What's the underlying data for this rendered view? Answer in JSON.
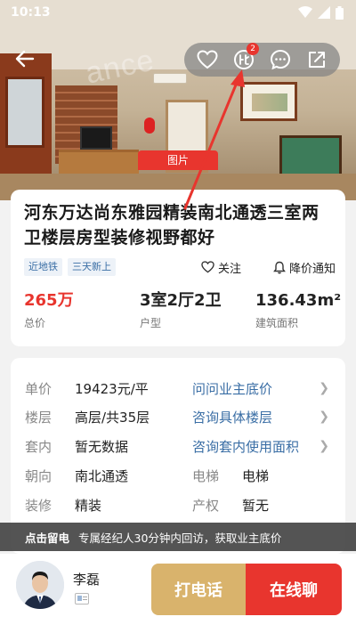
{
  "status_bar": {
    "time": "10:13",
    "icons": [
      "wifi-icon",
      "signal-icon",
      "battery-icon"
    ]
  },
  "hero": {
    "watermark": "ance",
    "photo_tag": "图片",
    "compare_badge": "2",
    "actions": [
      "heart-icon",
      "compare-icon",
      "chat-bubble-icon",
      "share-icon"
    ]
  },
  "listing": {
    "title": "河东万达尚东雅园精装南北通透三室两卫楼层房型装修视野都好",
    "tags": [
      "近地铁",
      "三天新上"
    ],
    "follow_label": "关注",
    "price_alert_label": "降价通知",
    "stats": [
      {
        "value": "265万",
        "label": "总价"
      },
      {
        "value": "3室2厅2卫",
        "label": "户型"
      },
      {
        "value": "136.43m²",
        "label": "建筑面积"
      }
    ]
  },
  "details": {
    "rows": [
      {
        "label": "单价",
        "value": "19423元/平",
        "link": "问问业主底价"
      },
      {
        "label": "楼层",
        "value": "高层/共35层",
        "link": "咨询具体楼层"
      },
      {
        "label": "套内",
        "value": "暂无数据",
        "link": "咨询套内使用面积"
      },
      {
        "label": "朝向",
        "value": "南北通透",
        "label2": "电梯",
        "value2": "电梯"
      },
      {
        "label": "装修",
        "value": "精装",
        "label2": "产权",
        "value2": "暂无"
      }
    ]
  },
  "toast": {
    "strong": "点击留电",
    "text": "专属经纪人30分钟内回访，获取业主底价"
  },
  "agent": {
    "name": "李磊"
  },
  "bottom_actions": {
    "call": "打电话",
    "chat": "在线聊"
  },
  "colors": {
    "accent_red": "#e8352e",
    "gold": "#d9b36c",
    "link_blue": "#3a6ea5"
  }
}
